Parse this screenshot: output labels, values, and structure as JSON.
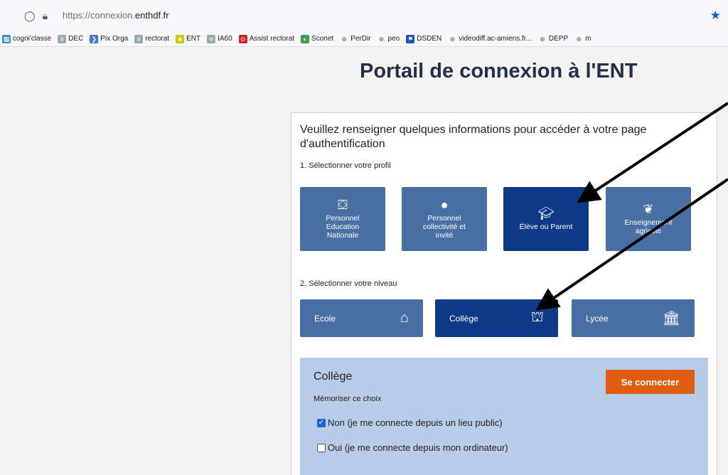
{
  "browser": {
    "url_prefix": "https://connexion.",
    "url_domain": "enthdf.fr",
    "bookmarks": [
      {
        "label": "cogni'classe",
        "icon": "app-icon",
        "color": "#3a8fd6"
      },
      {
        "label": "DEC",
        "icon": "ministry-icon",
        "color": "#9aa"
      },
      {
        "label": "Pix Orga",
        "icon": "pix-icon",
        "color": "#3a7bd5"
      },
      {
        "label": "rectorat",
        "icon": "ministry-icon",
        "color": "#9aa"
      },
      {
        "label": "ENT",
        "icon": "ent-icon",
        "color": "#c8c800"
      },
      {
        "label": "IA60",
        "icon": "ministry-icon",
        "color": "#9aa"
      },
      {
        "label": "Assist rectorat",
        "icon": "assist-icon",
        "color": "#d02020"
      },
      {
        "label": "Sconet",
        "icon": "sconet-icon",
        "color": "#3aa050"
      },
      {
        "label": "PerDir",
        "icon": "globe-icon",
        "color": "#666"
      },
      {
        "label": "peo",
        "icon": "globe-icon",
        "color": "#666"
      },
      {
        "label": "DSDEN",
        "icon": "flag-icon",
        "color": "#2050c0"
      },
      {
        "label": "videodiff.ac-amiens.fr...",
        "icon": "globe-icon",
        "color": "#666"
      },
      {
        "label": "DEPP",
        "icon": "globe-icon",
        "color": "#666"
      },
      {
        "label": "m",
        "icon": "globe-icon",
        "color": "#666"
      }
    ]
  },
  "page": {
    "title": "Portail de connexion à l'ENT",
    "intro": "Veuillez renseigner quelques informations pour accéder à votre page d'authentification",
    "step1": "1. Sélectionner votre profil",
    "step2": "2. Sélectionner votre niveau",
    "profiles": [
      {
        "l1": "Personnel",
        "l2": "Education",
        "l3": "Nationale",
        "icon": "teacher-board-icon",
        "selected": false
      },
      {
        "l1": "Personnel",
        "l2": "collectivité et",
        "l3": "invité",
        "icon": "person-icon",
        "selected": false
      },
      {
        "l1": "Élève ou Parent",
        "l2": "",
        "l3": "",
        "icon": "graduate-icon",
        "selected": true
      },
      {
        "l1": "Enseignement",
        "l2": "agricole",
        "l3": "",
        "icon": "leaf-icon",
        "selected": false
      }
    ],
    "levels": [
      {
        "label": "Ecole",
        "icon": "house-icon",
        "selected": false
      },
      {
        "label": "Collège",
        "icon": "school-building-icon",
        "selected": true
      },
      {
        "label": "Lycée",
        "icon": "institution-icon",
        "selected": false
      }
    ],
    "panel": {
      "title": "Collège",
      "connect_label": "Se connecter",
      "memo_label": "Mémoriser ce choix",
      "option_no": "Non (je me connecte depuis un lieu public)",
      "option_yes": "Oui (je me connecte depuis mon ordinateur)"
    }
  },
  "colors": {
    "tile": "#4a6fa5",
    "tile_selected": "#0e3a87",
    "connect_button": "#e05d10",
    "panel_bg": "#b8cce8"
  }
}
